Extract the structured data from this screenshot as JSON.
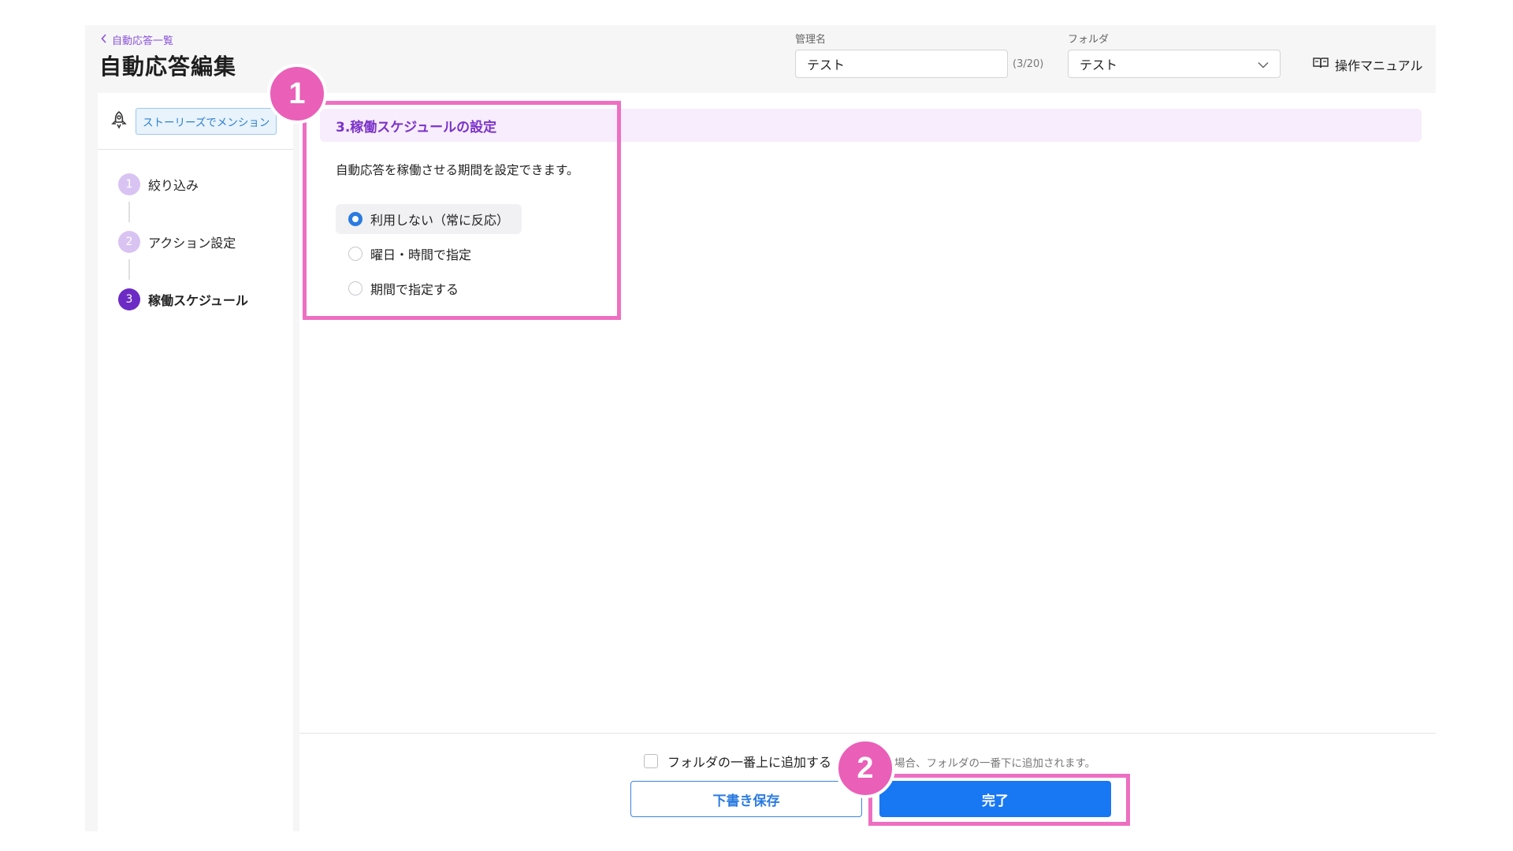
{
  "header": {
    "back_link": "自動応答一覧",
    "title": "自動応答編集",
    "name_label": "管理名",
    "name_value": "テスト",
    "name_counter": "(3/20)",
    "folder_label": "フォルダ",
    "folder_value": "テスト",
    "manual_label": "操作マニュアル"
  },
  "trigger": {
    "label": "ストーリーズでメンション"
  },
  "steps": [
    {
      "num": "1",
      "label": "絞り込み",
      "active": false
    },
    {
      "num": "2",
      "label": "アクション設定",
      "active": false
    },
    {
      "num": "3",
      "label": "稼働スケジュール",
      "active": true
    }
  ],
  "section": {
    "title": "3.稼働スケジュールの設定",
    "description": "自動応答を稼働させる期間を設定できます。",
    "options": [
      {
        "label": "利用しない（常に反応）",
        "selected": true
      },
      {
        "label": "曜日・時間で指定",
        "selected": false
      },
      {
        "label": "期間で指定する",
        "selected": false
      }
    ]
  },
  "footer": {
    "checkbox_label": "フォルダの一番上に追加する",
    "hint": "場合、フォルダの一番下に追加されます。",
    "draft_button": "下書き保存",
    "done_button": "完了"
  },
  "annotations": {
    "callout_1": "1",
    "callout_2": "2"
  },
  "colors": {
    "accent_purple": "#7b33c8",
    "primary_blue": "#1877f2",
    "highlight_pink": "#ee6fc2"
  }
}
